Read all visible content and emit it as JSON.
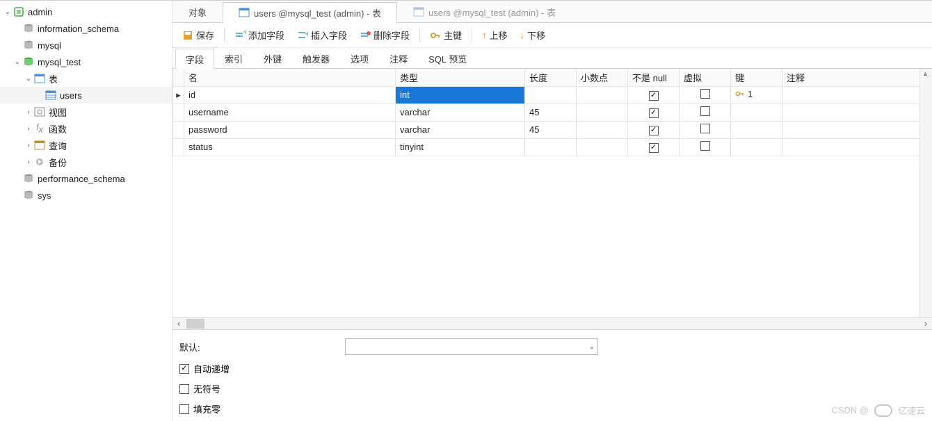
{
  "tree": {
    "admin": "admin",
    "information_schema": "information_schema",
    "mysql": "mysql",
    "mysql_test": "mysql_test",
    "tables": "表",
    "users": "users",
    "views": "视图",
    "functions": "函数",
    "queries": "查询",
    "backups": "备份",
    "performance_schema": "performance_schema",
    "sys": "sys"
  },
  "file_tabs": {
    "objects": "对象",
    "active": "users @mysql_test (admin) - 表",
    "inactive": "users @mysql_test (admin) - 表"
  },
  "toolbar": {
    "save": "保存",
    "add_field": "添加字段",
    "insert_field": "插入字段",
    "delete_field": "删除字段",
    "primary_key": "主键",
    "move_up": "上移",
    "move_down": "下移"
  },
  "subtabs": {
    "fields": "字段",
    "indexes": "索引",
    "foreign": "外键",
    "triggers": "触发器",
    "options": "选项",
    "comment": "注释",
    "sql_preview": "SQL 预览"
  },
  "columns": {
    "name": "名",
    "type": "类型",
    "length": "长度",
    "decimals": "小数点",
    "not_null": "不是 null",
    "virtual": "虚拟",
    "key": "键",
    "comment": "注释"
  },
  "rows": [
    {
      "name": "id",
      "type": "int",
      "length": "",
      "decimals": "",
      "not_null": true,
      "virtual": false,
      "key": "1",
      "selected_col": "type"
    },
    {
      "name": "username",
      "type": "varchar",
      "length": "45",
      "decimals": "",
      "not_null": true,
      "virtual": false,
      "key": ""
    },
    {
      "name": "password",
      "type": "varchar",
      "length": "45",
      "decimals": "",
      "not_null": true,
      "virtual": false,
      "key": ""
    },
    {
      "name": "status",
      "type": "tinyint",
      "length": "",
      "decimals": "",
      "not_null": true,
      "virtual": false,
      "key": ""
    }
  ],
  "props": {
    "default_label": "默认:",
    "default_value": "",
    "auto_increment": {
      "label": "自动递增",
      "checked": true
    },
    "unsigned": {
      "label": "无符号",
      "checked": false
    },
    "zerofill": {
      "label": "填充零",
      "checked": false
    }
  },
  "watermark": {
    "csdn": "CSDN @",
    "brand": "亿速云"
  }
}
